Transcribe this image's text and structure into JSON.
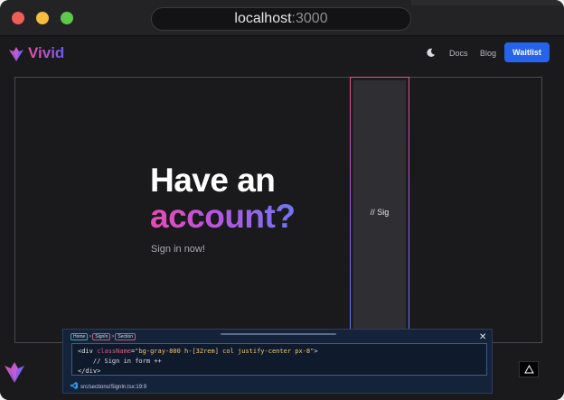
{
  "browser": {
    "url_host": "localhost",
    "url_port": ":3000"
  },
  "nav": {
    "brand": "Vivid",
    "links": [
      {
        "label": "Docs"
      },
      {
        "label": "Blog"
      }
    ],
    "cta_label": "Waitlist",
    "theme_icon": "moon-icon"
  },
  "hero": {
    "line1": "Have an",
    "line2": "account?",
    "subtitle": "Sign in now!"
  },
  "form_placeholder": "// Sig",
  "devtools": {
    "breadcrumbs": [
      "Home",
      "SignIn",
      "Section"
    ],
    "code": {
      "open_tag": "<div",
      "attr_name": "className",
      "attr_value": "\"bg-gray-800 h-[32rem] col justify-center px-8\"",
      "open_end": ">",
      "comment": "// Sign in form ++",
      "close_tag": "</div>"
    },
    "file_path": "src/sections/SignIn.tsx:19:9",
    "close_label": "✕"
  },
  "colors": {
    "accent_blue": "#2563eb",
    "gradient_pink": "#e64cb4",
    "gradient_blue": "#6e76f4",
    "background": "#1a191c"
  }
}
